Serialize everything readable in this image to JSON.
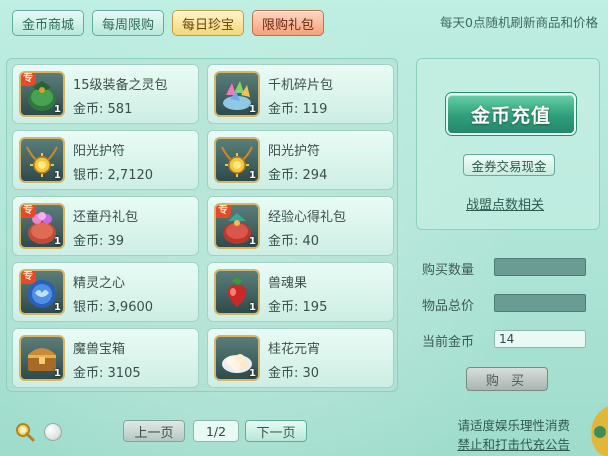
{
  "tabs": [
    {
      "label": "金币商城",
      "style": "normal"
    },
    {
      "label": "每周限购",
      "style": "normal"
    },
    {
      "label": "每日珍宝",
      "style": "active"
    },
    {
      "label": "限购礼包",
      "style": "gift"
    }
  ],
  "refresh_note": "每天0点随机刷新商品和价格",
  "items": [
    {
      "name": "15级装备之灵包",
      "currency": "金币:",
      "price": "581",
      "qty": "1",
      "badge": "专",
      "icon": "green-bag-icon"
    },
    {
      "name": "千机碎片包",
      "currency": "金币:",
      "price": "119",
      "qty": "1",
      "badge": "",
      "icon": "colorful-shards-icon"
    },
    {
      "name": "阳光护符",
      "currency": "银币:",
      "price": "2,7120",
      "qty": "1",
      "badge": "",
      "icon": "sun-amulet-icon"
    },
    {
      "name": "阳光护符",
      "currency": "金币:",
      "price": "294",
      "qty": "1",
      "badge": "",
      "icon": "sun-amulet-icon"
    },
    {
      "name": "还童丹礼包",
      "currency": "金币:",
      "price": "39",
      "qty": "1",
      "badge": "专",
      "icon": "pink-gift-bag-icon"
    },
    {
      "name": "经验心得礼包",
      "currency": "金币:",
      "price": "40",
      "qty": "1",
      "badge": "专",
      "icon": "red-gift-bag-icon"
    },
    {
      "name": "精灵之心",
      "currency": "银币:",
      "price": "3,9600",
      "qty": "1",
      "badge": "专",
      "icon": "spirit-heart-icon"
    },
    {
      "name": "兽魂果",
      "currency": "金币:",
      "price": "195",
      "qty": "1",
      "badge": "",
      "icon": "beast-soul-fruit-icon"
    },
    {
      "name": "魔兽宝箱",
      "currency": "金币:",
      "price": "3105",
      "qty": "1",
      "badge": "",
      "icon": "treasure-chest-icon"
    },
    {
      "name": "桂花元宵",
      "currency": "金币:",
      "price": "30",
      "qty": "1",
      "badge": "",
      "icon": "rice-balls-icon"
    }
  ],
  "side": {
    "recharge_label": "金币充值",
    "voucher_label": "金券交易现金",
    "alliance_link": "战盟点数相关"
  },
  "form": {
    "qty_label": "购买数量",
    "qty_value": "",
    "total_label": "物品总价",
    "total_value": "",
    "gold_label": "当前金币",
    "gold_value": "14",
    "buy_label": "购 买"
  },
  "pager": {
    "prev_label": "上一页",
    "page_indicator": "1/2",
    "next_label": "下一页"
  },
  "notices": {
    "line1": "请适度娱乐理性消费",
    "line2": "禁止和打击代充公告"
  },
  "colors": {
    "background": "#a6e3d4",
    "accent_green": "#2f9f7a",
    "active_tab": "#f3d67a",
    "gift_tab": "#f4a07a",
    "badge_red": "#e6492b"
  }
}
